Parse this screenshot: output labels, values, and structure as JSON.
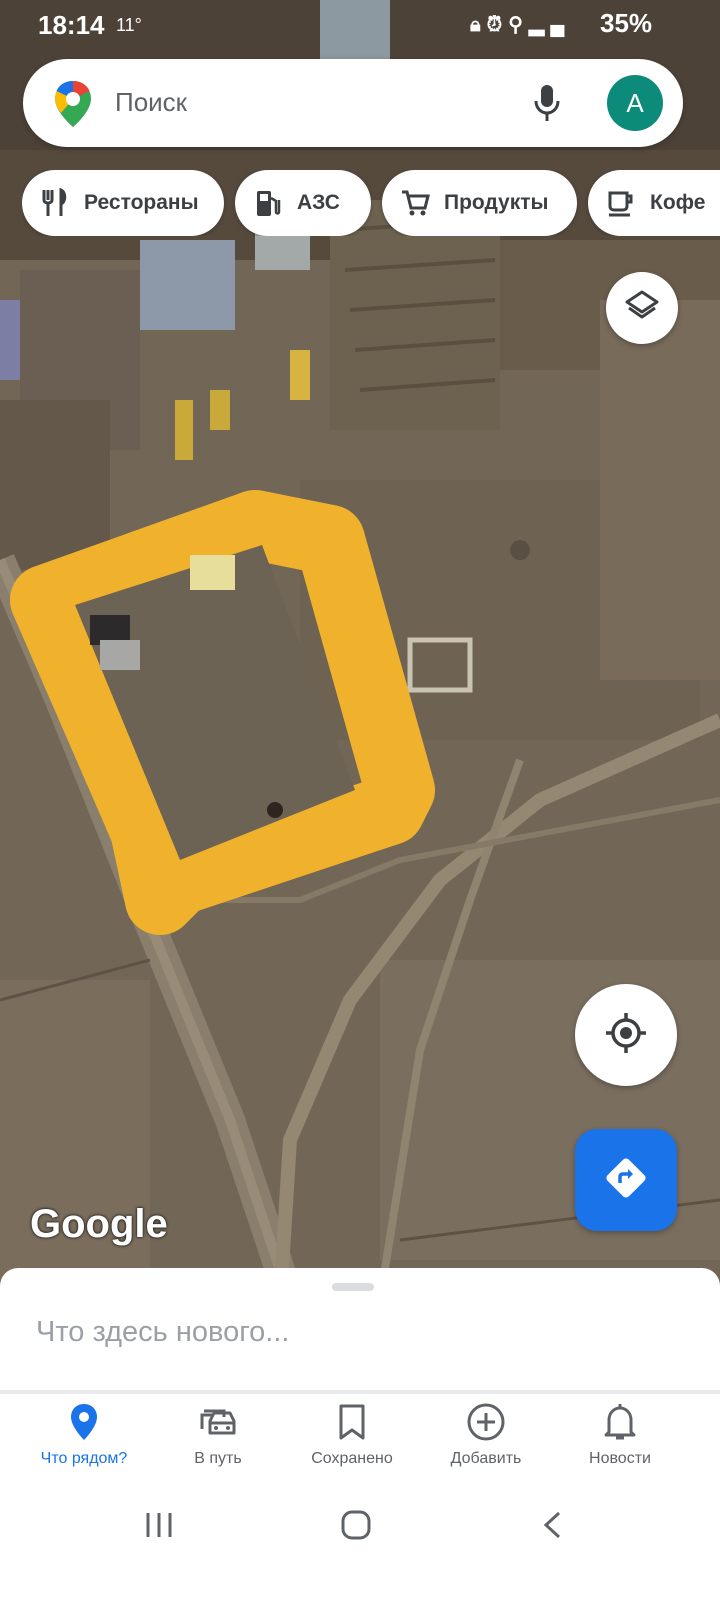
{
  "status": {
    "time": "18:14",
    "temp": "11°",
    "icons": [
      "lock-icon",
      "alarm-icon",
      "location-icon",
      "data-icon",
      "signal-icon"
    ],
    "battery": "35%"
  },
  "search": {
    "placeholder": "Поиск",
    "avatar_letter": "A"
  },
  "chips": [
    {
      "label": "Рестораны",
      "icon": "restaurant-icon"
    },
    {
      "label": "АЗС",
      "icon": "gas-station-icon"
    },
    {
      "label": "Продукты",
      "icon": "cart-icon"
    },
    {
      "label": "Кофе",
      "icon": "coffee-icon"
    }
  ],
  "map": {
    "attribution": "Google",
    "highlight_color": "#f0b22c"
  },
  "sheet": {
    "prompt": "Что здесь нового..."
  },
  "nav": [
    {
      "label": "Что рядом?",
      "icon": "location-pin-icon",
      "active": true
    },
    {
      "label": "В путь",
      "icon": "car-icon"
    },
    {
      "label": "Сохранено",
      "icon": "bookmark-icon"
    },
    {
      "label": "Добавить",
      "icon": "add-circle-icon"
    },
    {
      "label": "Новости",
      "icon": "bell-icon"
    }
  ],
  "colors": {
    "accent": "#1a73e8",
    "avatar": "#0c8a7a"
  }
}
